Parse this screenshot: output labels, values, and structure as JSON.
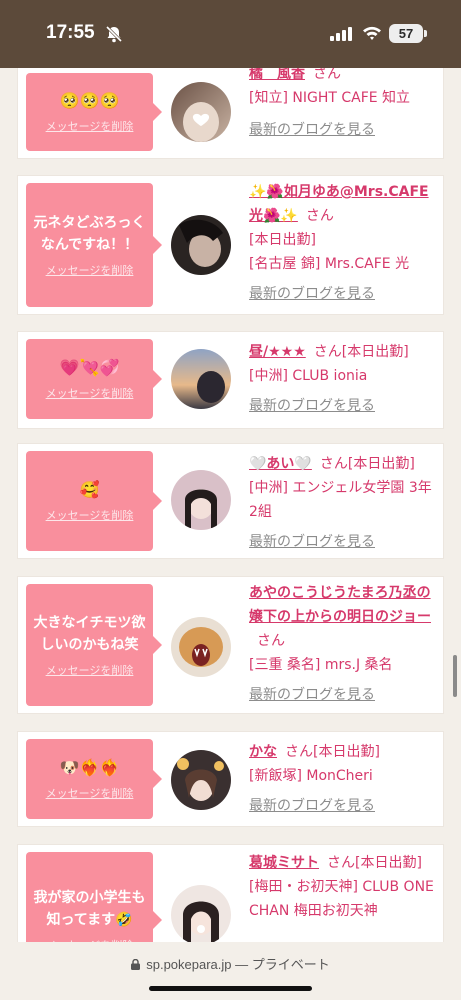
{
  "status_bar": {
    "time": "17:55",
    "battery": "57",
    "icons": [
      "bell-off-icon",
      "signal-icon",
      "wifi-icon",
      "battery-icon"
    ]
  },
  "delete_label": "メッセージを削除",
  "blog_label": "最新のブログを見る",
  "cards": [
    {
      "message": "🥺🥺🥺",
      "name": "橘　風香",
      "san": "さん",
      "status": "",
      "shop": "[知立] NIGHT CAFE 知立"
    },
    {
      "message": "元ネタどぶろっくなんですね！！",
      "name": "✨🌺如月ゆあ@Mrs.CAFE光🌺✨",
      "san": "さん",
      "status": "[本日出勤]",
      "shop": "[名古屋 錦] Mrs.CAFE 光"
    },
    {
      "message": "💗💘💞",
      "name": "昼/★★★",
      "san": "さん",
      "status": "[本日出勤]",
      "shop": "[中洲] CLUB ionia"
    },
    {
      "message": "🥰",
      "name": "🤍あい🤍",
      "san": "さん",
      "status": "[本日出勤]",
      "shop": "[中洲] エンジェル女学園 3年2組"
    },
    {
      "message": "大きなイチモツ欲しいのかもね笑",
      "name": "あやのこうじうたまろ乃丞の嬢下の上からの明日のジョー",
      "san": "さん",
      "status": "",
      "shop": "[三重 桑名] mrs.J 桑名"
    },
    {
      "message": "🐶❤️‍🔥❤️‍🔥",
      "name": "かな",
      "san": "さん",
      "status": "[本日出勤]",
      "shop": "[新飯塚] MonCheri"
    },
    {
      "message": "我が家の小学生も知ってます🤣",
      "name": "葛城ミサト",
      "san": "さん",
      "status": "[本日出勤]",
      "shop": "[梅田・お初天神] CLUB ONE CHAN 梅田お初天神"
    }
  ],
  "url_bar": {
    "domain": "sp.pokepara.jp",
    "mode": "— プライベート"
  },
  "colors": {
    "accent": "#d6396b",
    "bubble": "#f98f9d",
    "status_bar": "#5c4a3a"
  }
}
